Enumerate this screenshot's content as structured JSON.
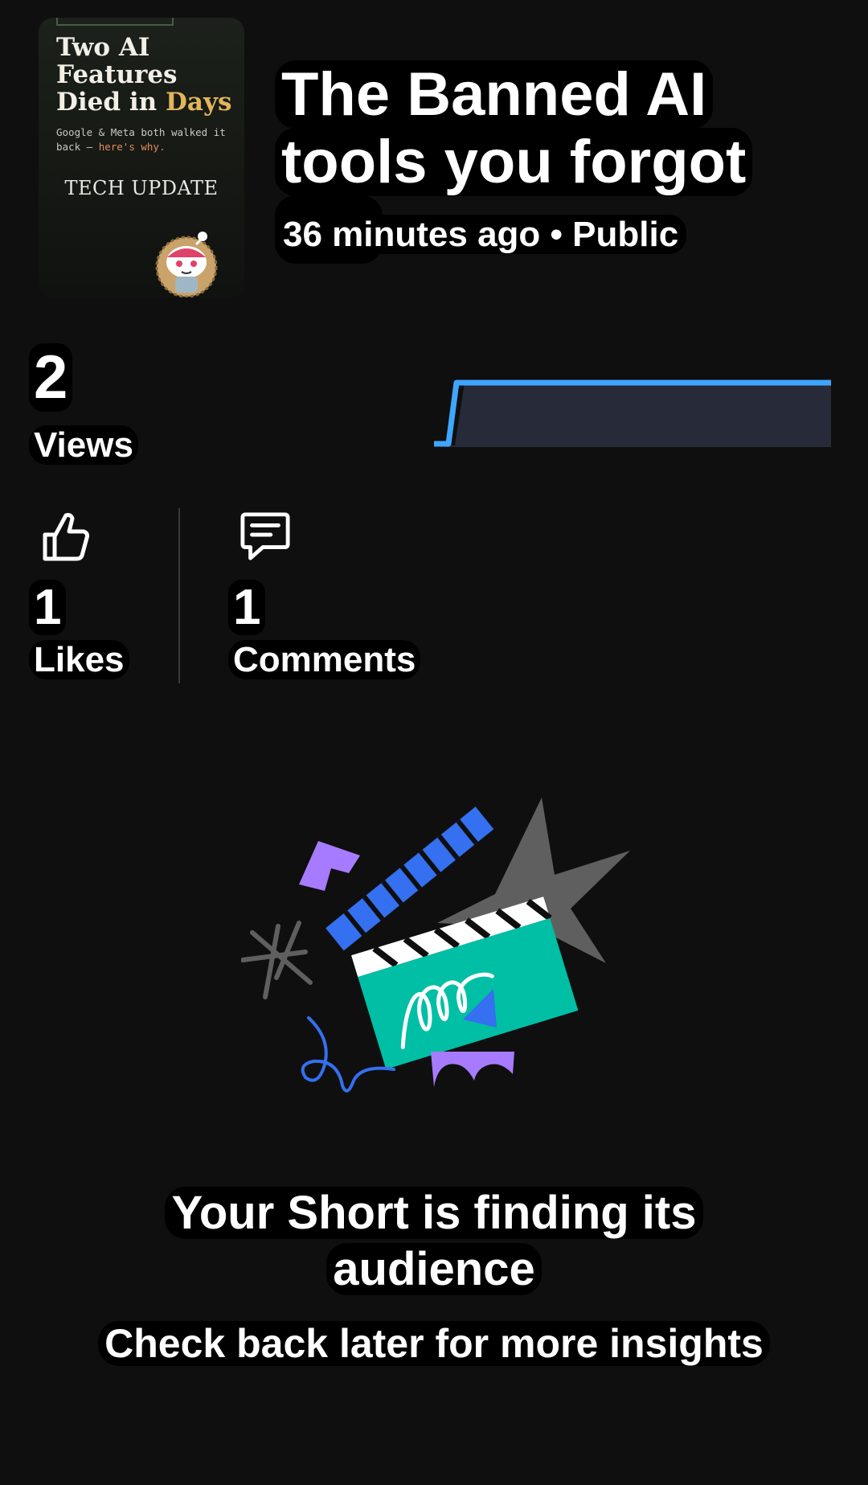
{
  "video": {
    "thumbnail": {
      "headline_part1": "Two AI Features Died in ",
      "headline_accent": "Days",
      "subline_part1": "Google & Meta both walked it back — ",
      "subline_accent": "here's why.",
      "tag": "TECH UPDATE",
      "mascot_icon": "reddit-style-mascot-icon"
    },
    "title": "The Banned AI tools you forgot a…",
    "meta": "36 minutes ago • Public"
  },
  "views": {
    "value": "2",
    "label": "Views",
    "trend_icon": "views-sparkline"
  },
  "stats": {
    "likes": {
      "value": "1",
      "label": "Likes",
      "icon": "thumbs-up-icon"
    },
    "comments": {
      "value": "1",
      "label": "Comments",
      "icon": "comment-icon"
    }
  },
  "empty_state": {
    "title": "Your Short is finding its audience",
    "subtitle": "Check back later for more insights",
    "illustration": "clapperboard-illustration"
  },
  "colors": {
    "background": "#0f0f0f",
    "text": "#ffffff",
    "text_backdrop": "#000000",
    "sparkline_stroke": "#3ea6ff",
    "sparkline_fill": "#272a38",
    "clapper_green": "#00bfa5",
    "accent_blue": "#3470f0",
    "accent_purple": "#a77bff",
    "star_gray": "#5f5f5f"
  }
}
